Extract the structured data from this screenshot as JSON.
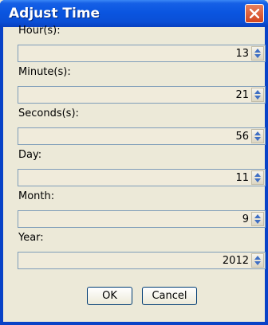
{
  "window": {
    "title": "Adjust Time"
  },
  "fields": [
    {
      "label": "Hour(s):",
      "value": "13"
    },
    {
      "label": "Minute(s):",
      "value": "21"
    },
    {
      "label": "Seconds(s):",
      "value": "56"
    },
    {
      "label": "Day:",
      "value": "11"
    },
    {
      "label": "Month:",
      "value": "9"
    },
    {
      "label": "Year:",
      "value": "2012"
    }
  ],
  "buttons": {
    "ok": "OK",
    "cancel": "Cancel"
  },
  "colors": {
    "titlebar": "#0a55e0",
    "close": "#d2451f",
    "dialog_bg": "#ece9d8",
    "field_bg": "#f0ebdb",
    "spin_arrow": "#3f6fc4"
  }
}
